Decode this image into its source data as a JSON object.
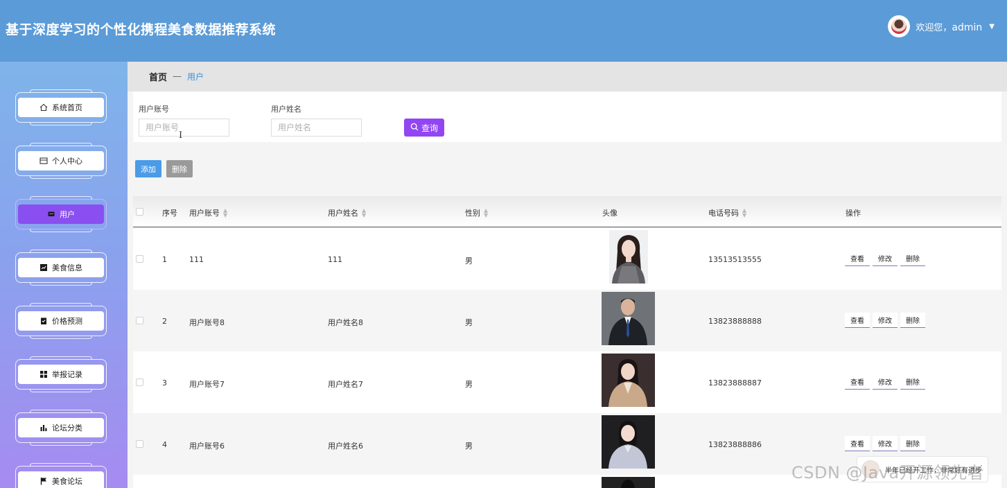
{
  "header": {
    "title": "基于深度学习的个性化携程美食数据推荐系统",
    "welcome": "欢迎您，",
    "username": "admin"
  },
  "sidebar": {
    "items": [
      {
        "label": "系统首页",
        "icon": "home-icon"
      },
      {
        "label": "个人中心",
        "icon": "id-card-icon"
      },
      {
        "label": "用户",
        "icon": "chat-icon",
        "active": true
      },
      {
        "label": "美食信息",
        "icon": "chart-up-icon"
      },
      {
        "label": "价格预测",
        "icon": "clipboard-check-icon"
      },
      {
        "label": "举报记录",
        "icon": "grid-icon"
      },
      {
        "label": "论坛分类",
        "icon": "bar-chart-icon"
      },
      {
        "label": "美食论坛",
        "icon": "flag-icon"
      }
    ]
  },
  "breadcrumb": {
    "home": "首页",
    "separator": "—",
    "current": "用户"
  },
  "search": {
    "account_label": "用户账号",
    "account_placeholder": "用户账号",
    "name_label": "用户姓名",
    "name_placeholder": "用户姓名",
    "query_label": "查询"
  },
  "actions": {
    "add": "添加",
    "delete": "删除"
  },
  "table": {
    "headers": {
      "index": "序号",
      "account": "用户账号",
      "name": "用户姓名",
      "gender": "性别",
      "avatar": "头像",
      "phone": "电话号码",
      "ops": "操作"
    },
    "ops": {
      "view": "查看",
      "edit": "修改",
      "delete": "删除"
    },
    "rows": [
      {
        "index": "1",
        "account": "111",
        "name": "111",
        "gender": "男",
        "phone": "13513513555"
      },
      {
        "index": "2",
        "account": "用户账号8",
        "name": "用户姓名8",
        "gender": "男",
        "phone": "13823888888"
      },
      {
        "index": "3",
        "account": "用户账号7",
        "name": "用户姓名7",
        "gender": "男",
        "phone": "13823888887"
      },
      {
        "index": "4",
        "account": "用户账号6",
        "name": "用户姓名6",
        "gender": "男",
        "phone": "13823888886"
      }
    ]
  },
  "overlay": {
    "watermark": "CSDN @Java开源领先者",
    "chat_text": "半年已经开工作，非常好有进步"
  },
  "colors": {
    "header": "#5b9bd8",
    "active_nav": "#8a4ff0",
    "query_button": "#9146f2",
    "add_button": "#4a9be8",
    "delete_button": "#9a9a9a"
  }
}
